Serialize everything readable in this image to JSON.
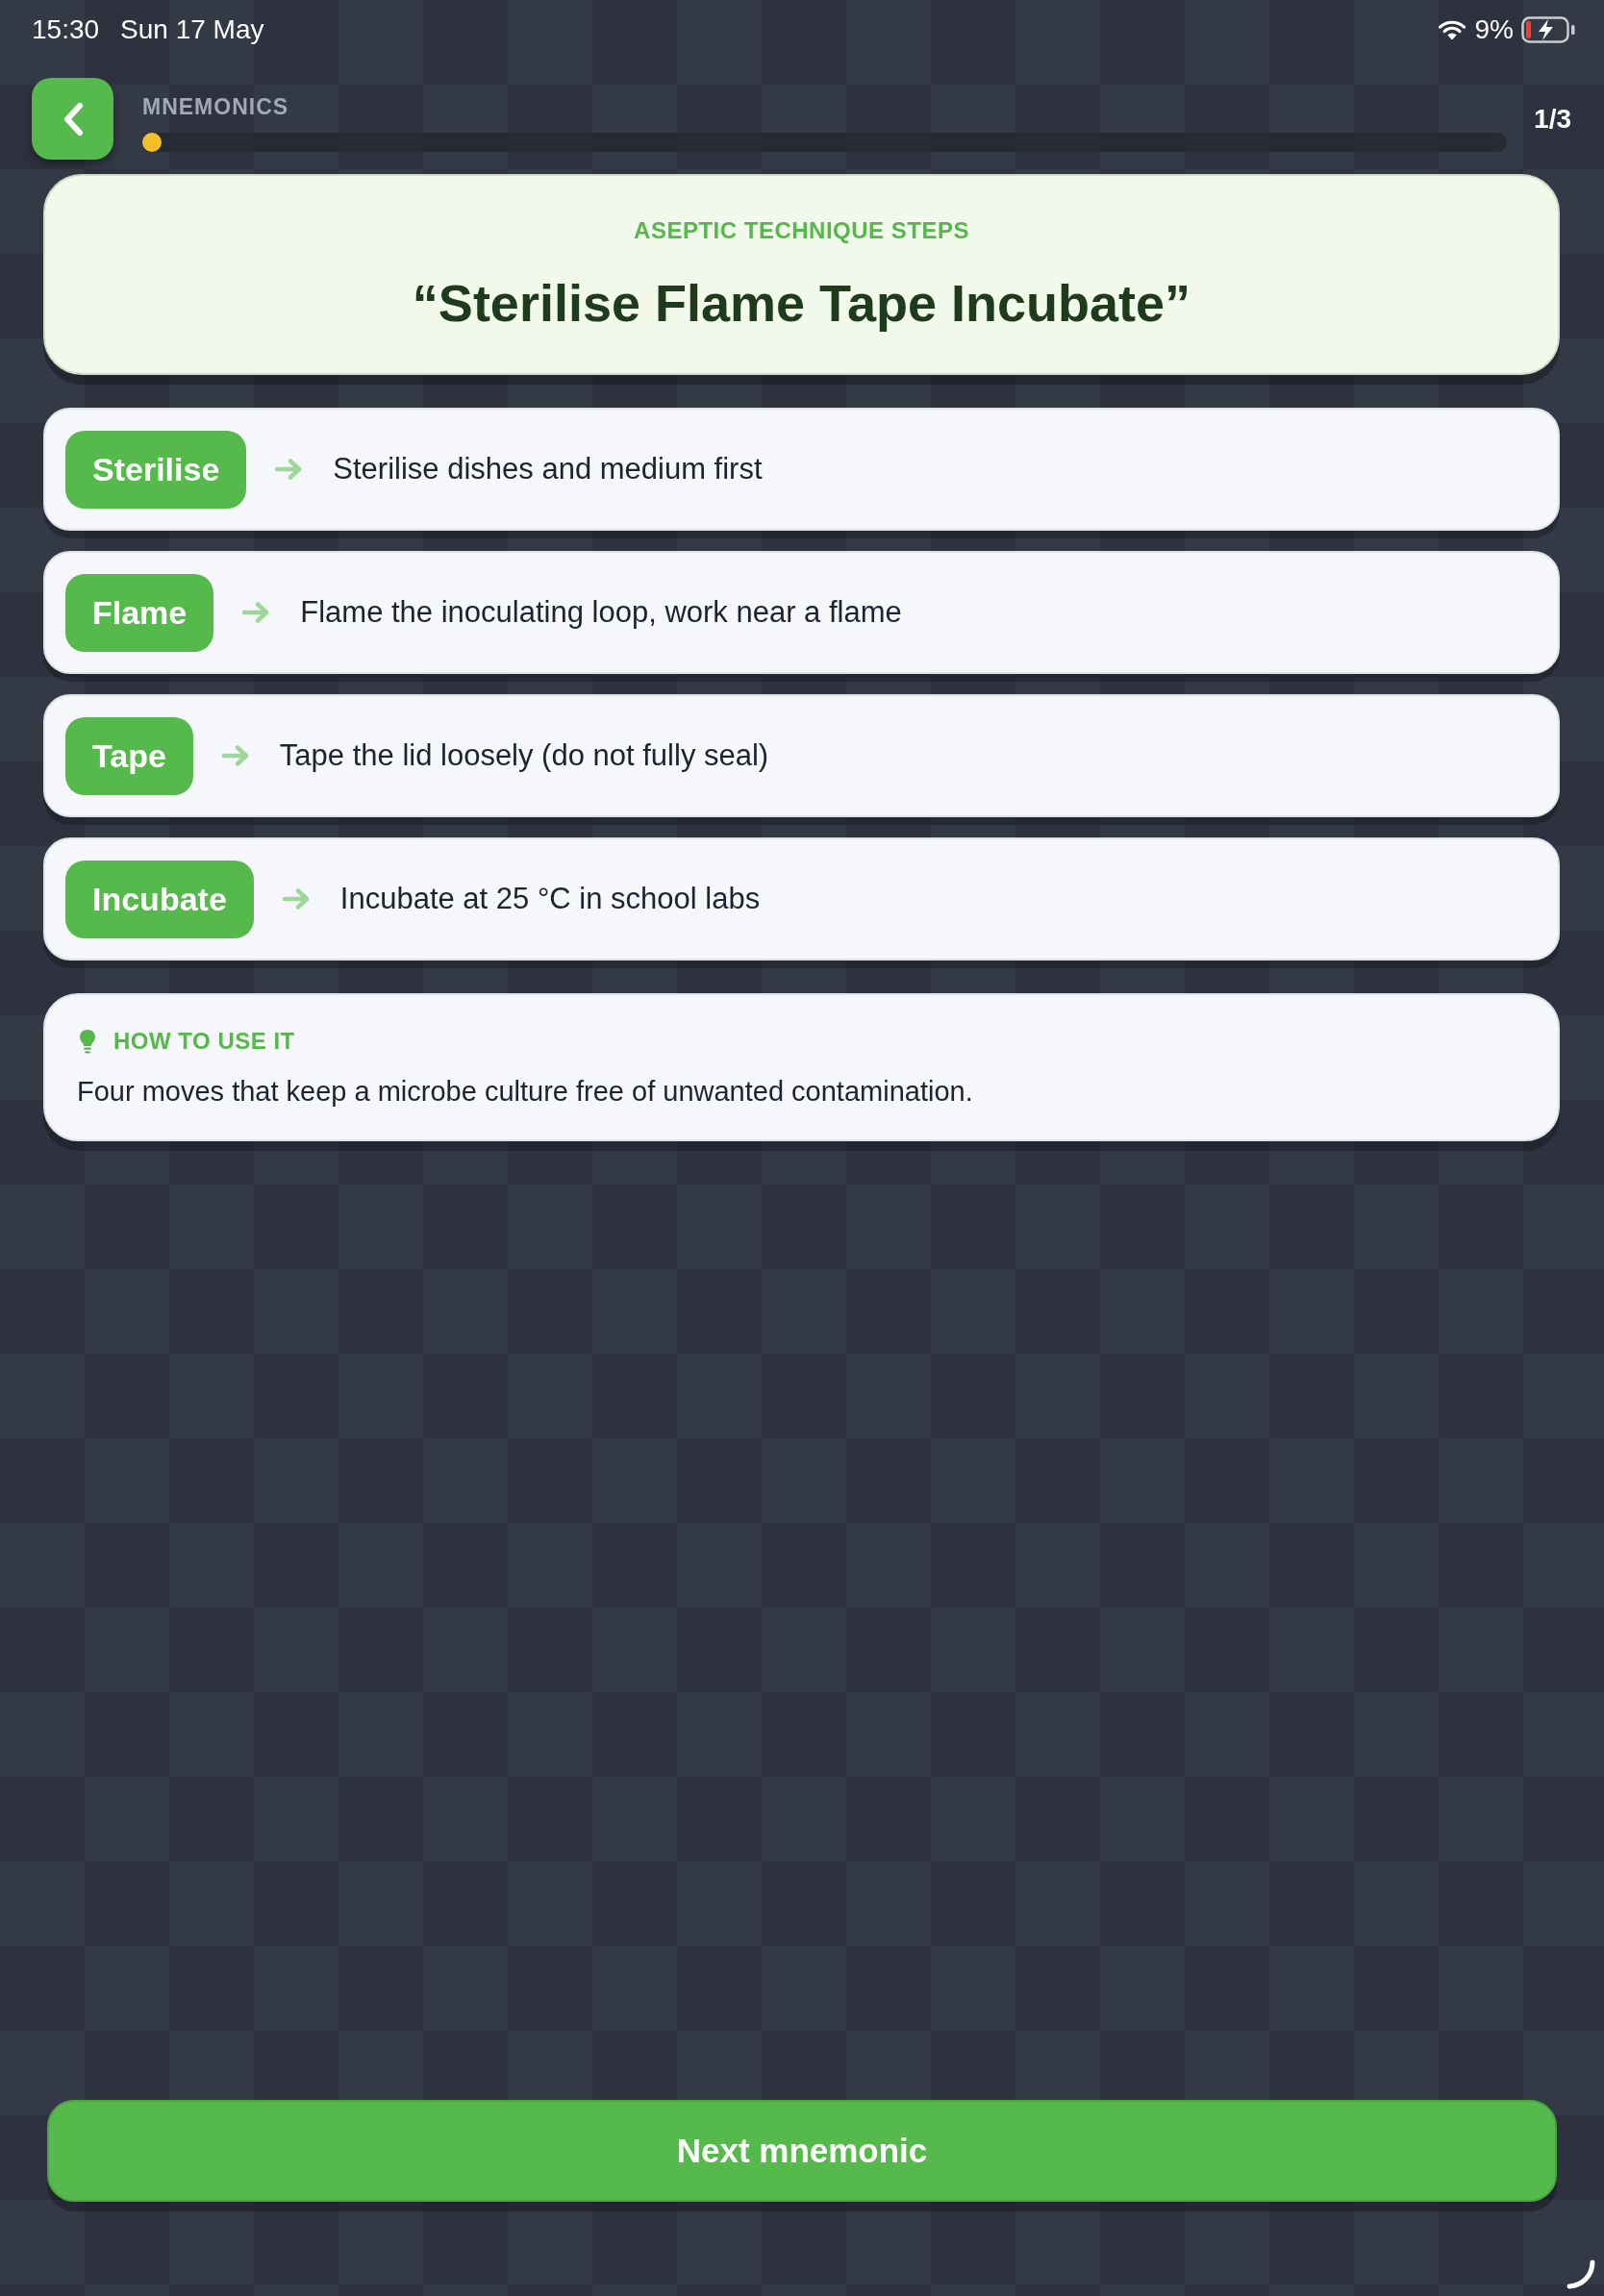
{
  "status_bar": {
    "time": "15:30",
    "date": "Sun 17 May",
    "battery_percent": "9%"
  },
  "header": {
    "section": "MNEMONICS",
    "progress": {
      "level": 0
    },
    "counter": "1/3"
  },
  "mnemonic": {
    "category": "ASEPTIC TECHNIQUE STEPS",
    "phrase": "“Sterilise Flame Tape Incubate”"
  },
  "steps": [
    {
      "keyword": "Sterilise",
      "description": "Sterilise dishes and medium first"
    },
    {
      "keyword": "Flame",
      "description": "Flame the inoculating loop, work near a flame"
    },
    {
      "keyword": "Tape",
      "description": "Tape the lid loosely (do not fully seal)"
    },
    {
      "keyword": "Incubate",
      "description": "Incubate at 25 °C in school labs"
    }
  ],
  "tip": {
    "heading": "HOW TO USE IT",
    "text": "Four moves that keep a microbe culture free of unwanted contamination."
  },
  "next_button": {
    "label": "Next mnemonic"
  }
}
